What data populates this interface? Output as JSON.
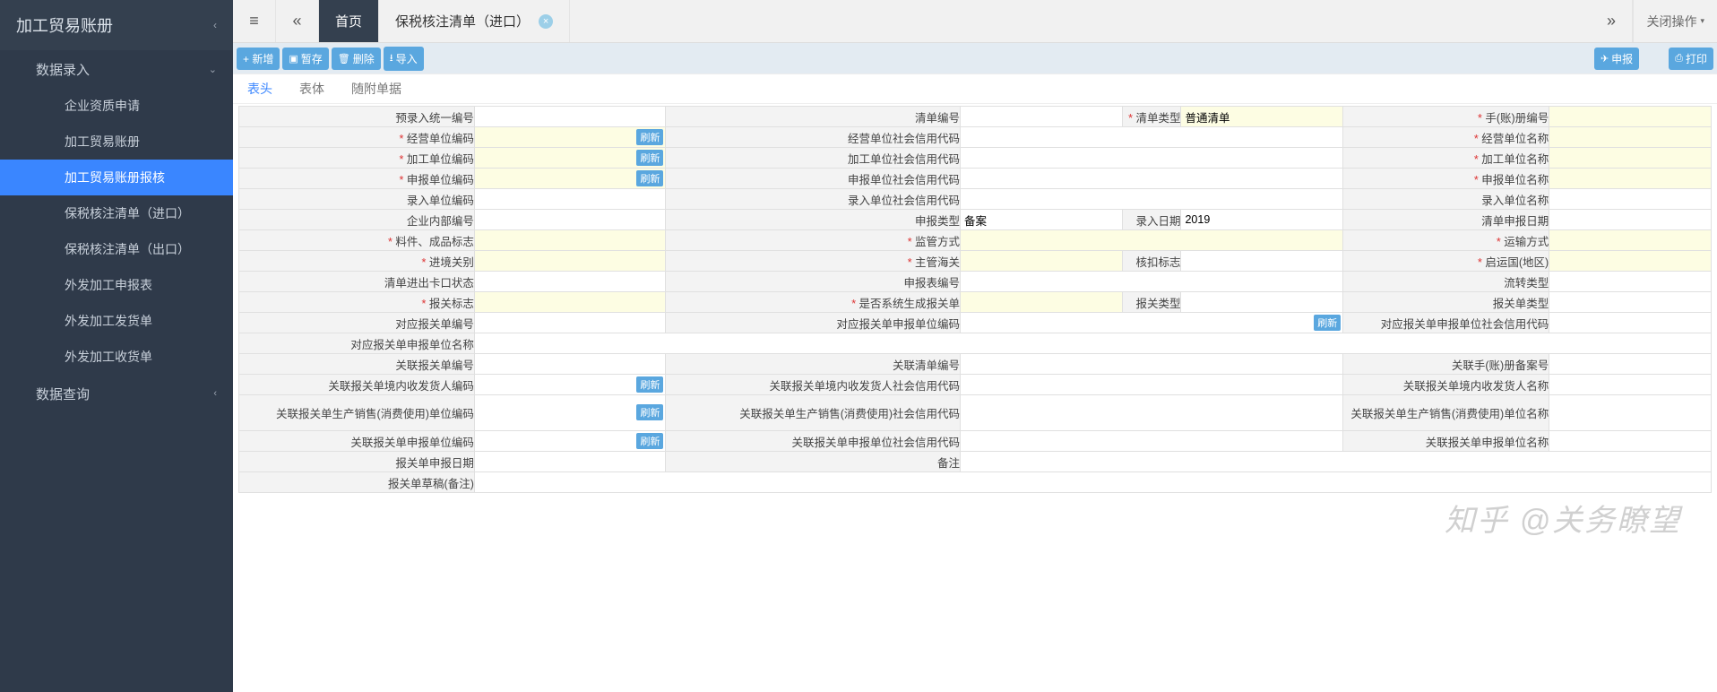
{
  "sidebar": {
    "title": "加工贸易账册",
    "groups": [
      {
        "label": "数据录入",
        "expanded": true
      },
      {
        "label": "数据查询",
        "expanded": false
      }
    ],
    "items": [
      "企业资质申请",
      "加工贸易账册",
      "加工贸易账册报核",
      "保税核注清单（进口）",
      "保税核注清单（出口）",
      "外发加工申报表",
      "外发加工发货单",
      "外发加工收货单"
    ],
    "activeIndex": 2
  },
  "tabs": {
    "home": "首页",
    "current": "保税核注清单（进口）",
    "closeOp": "关闭操作"
  },
  "toolbar": {
    "add": "+ 新增",
    "save": "暂存",
    "delete": "删除",
    "import": "导入",
    "send": "申报",
    "print": "打印"
  },
  "subtabs": [
    "表头",
    "表体",
    "随附单据"
  ],
  "refresh": "刷新",
  "form": {
    "r1": {
      "l1": "预录入统一编号",
      "l2": "清单编号",
      "l3": "清单类型",
      "v3": "普通清单",
      "l4": "手(账)册编号"
    },
    "r2": {
      "l1": "经营单位编码",
      "l2": "经营单位社会信用代码",
      "l3": "经营单位名称"
    },
    "r3": {
      "l1": "加工单位编码",
      "l2": "加工单位社会信用代码",
      "l3": "加工单位名称"
    },
    "r4": {
      "l1": "申报单位编码",
      "l2": "申报单位社会信用代码",
      "l3": "申报单位名称"
    },
    "r5": {
      "l1": "录入单位编码",
      "l2": "录入单位社会信用代码",
      "l3": "录入单位名称"
    },
    "r6": {
      "l1": "企业内部编号",
      "l2": "申报类型",
      "v2": "备案",
      "l3": "录入日期",
      "v3": "2019",
      "l4": "清单申报日期"
    },
    "r7": {
      "l1": "料件、成品标志",
      "l2": "监管方式",
      "l3": "运输方式"
    },
    "r8": {
      "l1": "进境关别",
      "l2": "主管海关",
      "l3": "核扣标志",
      "l4": "启运国(地区)"
    },
    "r9": {
      "l1": "清单进出卡口状态",
      "l2": "申报表编号",
      "l3": "流转类型"
    },
    "r10": {
      "l1": "报关标志",
      "l2": "是否系统生成报关单",
      "l3": "报关类型",
      "l4": "报关单类型"
    },
    "r11": {
      "l1": "对应报关单编号",
      "l2": "对应报关单申报单位编码",
      "l3": "对应报关单申报单位社会信用代码"
    },
    "r12": {
      "l1": "对应报关单申报单位名称"
    },
    "r13": {
      "l1": "关联报关单编号",
      "l2": "关联清单编号",
      "l3": "关联手(账)册备案号"
    },
    "r14": {
      "l1": "关联报关单境内收发货人编码",
      "l2": "关联报关单境内收发货人社会信用代码",
      "l3": "关联报关单境内收发货人名称"
    },
    "r15": {
      "l1": "关联报关单生产销售(消费使用)单位编码",
      "l2": "关联报关单生产销售(消费使用)社会信用代码",
      "l3": "关联报关单生产销售(消费使用)单位名称"
    },
    "r16": {
      "l1": "关联报关单申报单位编码",
      "l2": "关联报关单申报单位社会信用代码",
      "l3": "关联报关单申报单位名称"
    },
    "r17": {
      "l1": "报关单申报日期",
      "l2": "备注"
    },
    "r18": {
      "l1": "报关单草稿(备注)"
    }
  },
  "watermark": "知乎 @关务瞭望"
}
